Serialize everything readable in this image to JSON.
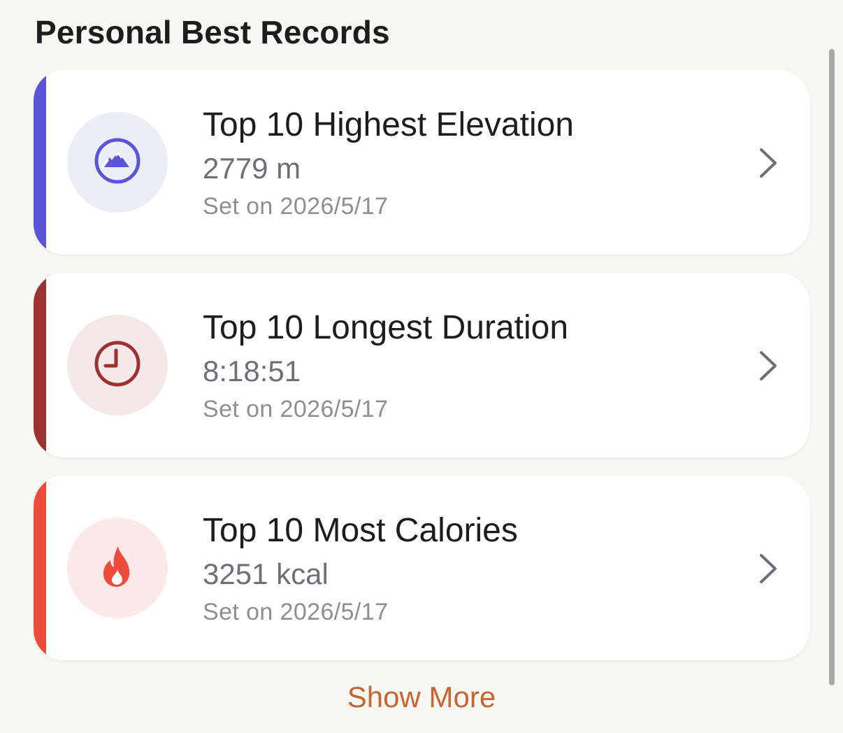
{
  "section": {
    "title": "Personal Best Records"
  },
  "records": [
    {
      "title": "Top 10 Highest Elevation",
      "value": "2779 m",
      "date": "Set on 2026/5/17",
      "icon": "mountain-icon",
      "accent_color": "#5856d6",
      "icon_bg": "#ededf8"
    },
    {
      "title": "Top 10 Longest Duration",
      "value": "8:18:51",
      "date": "Set on 2026/5/17",
      "icon": "clock-icon",
      "accent_color": "#9b3230",
      "icon_bg": "#f4e9e8"
    },
    {
      "title": "Top 10 Most Calories",
      "value": "3251 kcal",
      "date": "Set on 2026/5/17",
      "icon": "flame-icon",
      "accent_color": "#ec4c3c",
      "icon_bg": "#fbeae8"
    }
  ],
  "footer": {
    "show_more_label": "Show More"
  },
  "colors": {
    "link": "#c8642f",
    "background": "#f7f7f3"
  }
}
